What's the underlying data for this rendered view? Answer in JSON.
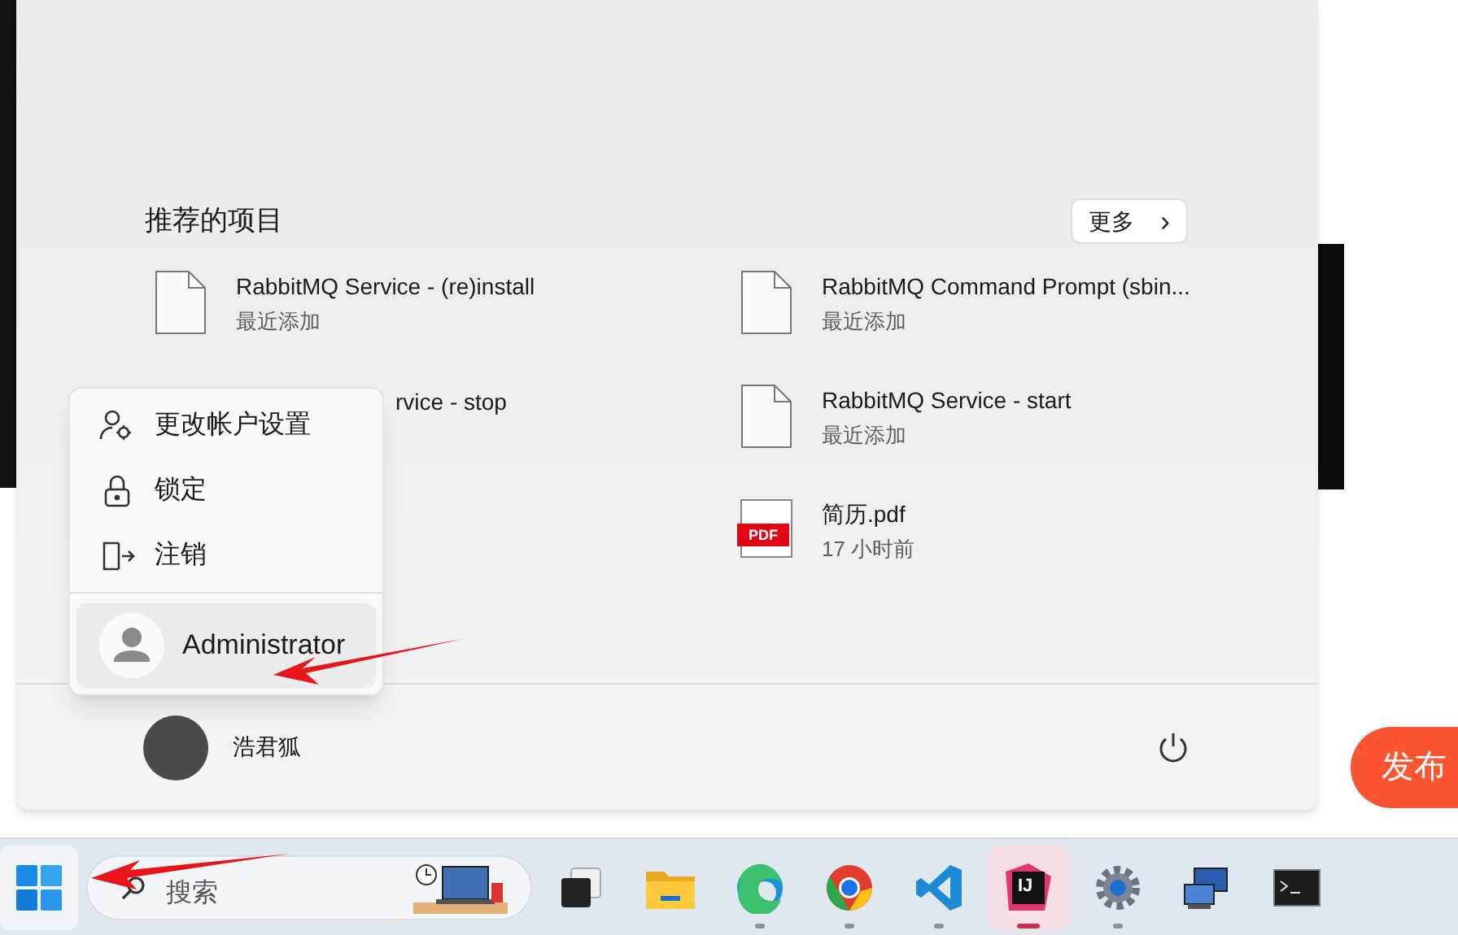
{
  "background": {
    "publish_button": "发布"
  },
  "start_menu": {
    "recommended": {
      "title": "推荐的项目",
      "more_button": "更多",
      "more_icon": "›",
      "items": [
        {
          "kind": "file",
          "title": "RabbitMQ Service - (re)install",
          "subtitle": "最近添加"
        },
        {
          "kind": "file",
          "title": "RabbitMQ Command Prompt (sbin...",
          "subtitle": "最近添加"
        },
        {
          "kind": "partial",
          "title": "rvice - stop"
        },
        {
          "kind": "file",
          "title": "RabbitMQ Service - start",
          "subtitle": "最近添加"
        },
        {
          "kind": "empty"
        },
        {
          "kind": "pdf",
          "title": "简历.pdf",
          "subtitle": "17 小时前",
          "badge": "PDF"
        }
      ]
    },
    "user": {
      "name": "浩君狐"
    },
    "account_menu": {
      "items": [
        {
          "kind": "settings",
          "label": "更改帐户设置"
        },
        {
          "kind": "lock",
          "label": "锁定"
        },
        {
          "kind": "signout",
          "label": "注销"
        }
      ],
      "other_user": {
        "name": "Administrator",
        "selected": true
      }
    }
  },
  "taskbar": {
    "search": {
      "placeholder": "搜索"
    },
    "apps": [
      {
        "kind": "taskview",
        "running": false,
        "active": false
      },
      {
        "kind": "explorer",
        "running": false,
        "active": false
      },
      {
        "kind": "edge",
        "running": true,
        "active": false
      },
      {
        "kind": "chrome",
        "running": true,
        "active": false
      },
      {
        "kind": "vscode",
        "running": true,
        "active": false
      },
      {
        "kind": "intellij",
        "running": true,
        "active": true,
        "label": "IJ"
      },
      {
        "kind": "settings",
        "running": true,
        "active": false
      },
      {
        "kind": "remote",
        "running": false,
        "active": false
      },
      {
        "kind": "terminal",
        "running": false,
        "active": false
      }
    ]
  }
}
